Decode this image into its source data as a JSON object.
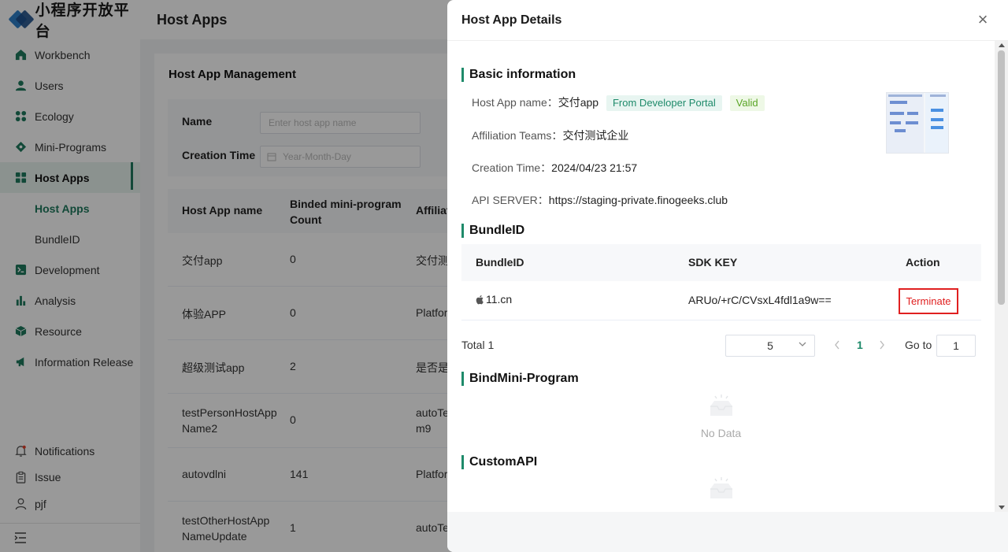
{
  "sidebar": {
    "logo_text": "小程序开放平台",
    "items": [
      {
        "label": "Workbench",
        "icon": "home-icon"
      },
      {
        "label": "Users",
        "icon": "user-icon"
      },
      {
        "label": "Ecology",
        "icon": "grid-icon"
      },
      {
        "label": "Mini-Programs",
        "icon": "diamond-icon"
      },
      {
        "label": "Host Apps",
        "icon": "apps-icon",
        "active": true
      },
      {
        "label": "Host Apps",
        "sub": true,
        "active": true
      },
      {
        "label": "BundleID",
        "sub": true
      },
      {
        "label": "Development",
        "icon": "terminal-icon"
      },
      {
        "label": "Analysis",
        "icon": "chart-icon"
      },
      {
        "label": "Resource",
        "icon": "cube-icon"
      },
      {
        "label": "Information Release",
        "icon": "megaphone-icon"
      }
    ],
    "bottom": [
      {
        "label": "Notifications",
        "icon": "bell-icon"
      },
      {
        "label": "Issue",
        "icon": "clipboard-icon"
      },
      {
        "label": "pjf",
        "icon": "person-icon"
      }
    ]
  },
  "main": {
    "page_title": "Host Apps",
    "card_title": "Host App Management",
    "filters": {
      "name_label": "Name",
      "name_placeholder": "Enter host app name",
      "time_label": "Creation Time",
      "time_placeholder": "Year-Month-Day"
    },
    "table": {
      "headers": [
        "Host App name",
        "Binded mini-program Count",
        "Affiliat"
      ],
      "rows": [
        {
          "name": "交付app",
          "count": "0",
          "team": "交付测试"
        },
        {
          "name": "体验APP",
          "count": "0",
          "team": "Platfor"
        },
        {
          "name": "超级测试app",
          "count": "2",
          "team": "是否是"
        },
        {
          "name": "testPersonHostApp Name2",
          "count": "0",
          "team": "autoTe m9"
        },
        {
          "name": "autovdlni",
          "count": "141",
          "team": "Platfor"
        },
        {
          "name": "testOtherHostApp NameUpdate",
          "count": "1",
          "team": "autoTe"
        }
      ]
    }
  },
  "drawer": {
    "title": "Host App Details",
    "basic": {
      "section_title": "Basic information",
      "name_label": "Host App name：",
      "name_value": "交付app",
      "tag_source": "From Developer Portal",
      "tag_status": "Valid",
      "teams_label": "Affiliation Teams：",
      "teams_value": "交付测试企业",
      "time_label": "Creation Time：",
      "time_value": "2024/04/23 21:57",
      "api_label": "API SERVER：",
      "api_value": "https://staging-private.finogeeks.club"
    },
    "bundle": {
      "section_title": "BundleID",
      "headers": [
        "BundleID",
        "SDK KEY",
        "Action"
      ],
      "row": {
        "bundle_id": "11.cn",
        "sdk_key": "ARUo/+rC/CVsxL4fdl1a9w==",
        "action": "Terminate"
      }
    },
    "pager": {
      "total": "Total 1",
      "page_size": "5",
      "current_page": "1",
      "goto_label": "Go to",
      "goto_value": "1"
    },
    "bind_section": {
      "title": "BindMini-Program",
      "empty": "No Data"
    },
    "custom_api": {
      "title": "CustomAPI"
    },
    "colors": {
      "accent": "#1e8a6a",
      "danger": "#e02020",
      "valid": "#5aa526"
    }
  }
}
